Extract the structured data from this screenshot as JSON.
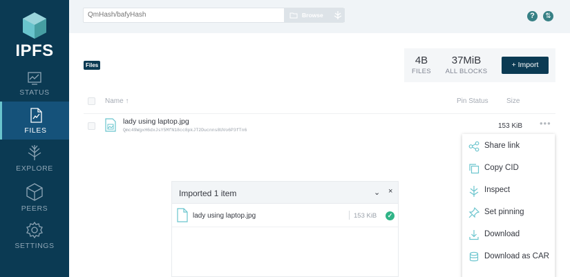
{
  "app": {
    "logo_text": "IPFS"
  },
  "sidebar": {
    "items": [
      {
        "label": "STATUS",
        "icon": "status-icon"
      },
      {
        "label": "FILES",
        "icon": "files-icon",
        "active": true
      },
      {
        "label": "EXPLORE",
        "icon": "explore-icon"
      },
      {
        "label": "PEERS",
        "icon": "peers-icon"
      },
      {
        "label": "SETTINGS",
        "icon": "settings-icon"
      }
    ]
  },
  "topbar": {
    "search_placeholder": "QmHash/bafyHash",
    "browse_label": "Browse"
  },
  "main": {
    "breadcrumb": "Files",
    "stats": [
      {
        "value": "4B",
        "label": "FILES"
      },
      {
        "value": "37MiB",
        "label": "ALL BLOCKS"
      }
    ],
    "import_label": "+ Import",
    "columns": {
      "name": "Name ↑",
      "pin_status": "Pin Status",
      "size": "Size"
    },
    "rows": [
      {
        "name": "lady using laptop.jpg",
        "cid": "Qmc49WgxH6dxJsY5MfN18cc8pkJT2Ducnns8UVo6P3fTn6",
        "size": "153 KiB",
        "more": "•••"
      }
    ]
  },
  "context_menu": {
    "items": [
      {
        "label": "Share link",
        "icon": "share-icon"
      },
      {
        "label": "Copy CID",
        "icon": "copy-icon"
      },
      {
        "label": "Inspect",
        "icon": "inspect-icon"
      },
      {
        "label": "Set pinning",
        "icon": "pin-icon"
      },
      {
        "label": "Download",
        "icon": "download-icon"
      },
      {
        "label": "Download as CAR",
        "icon": "download-car-icon"
      }
    ]
  },
  "import_panel": {
    "title": "Imported 1 item",
    "chevron": "⌄",
    "close": "×",
    "items": [
      {
        "name": "lady using laptop.jpg",
        "size": "153 KiB",
        "check": "✓"
      }
    ]
  },
  "colors": {
    "sidebar": "#0b3a53",
    "sidebar_active": "#15527a",
    "accent": "#378085",
    "success": "#30b487",
    "icon_teal": "#69c4cd"
  }
}
